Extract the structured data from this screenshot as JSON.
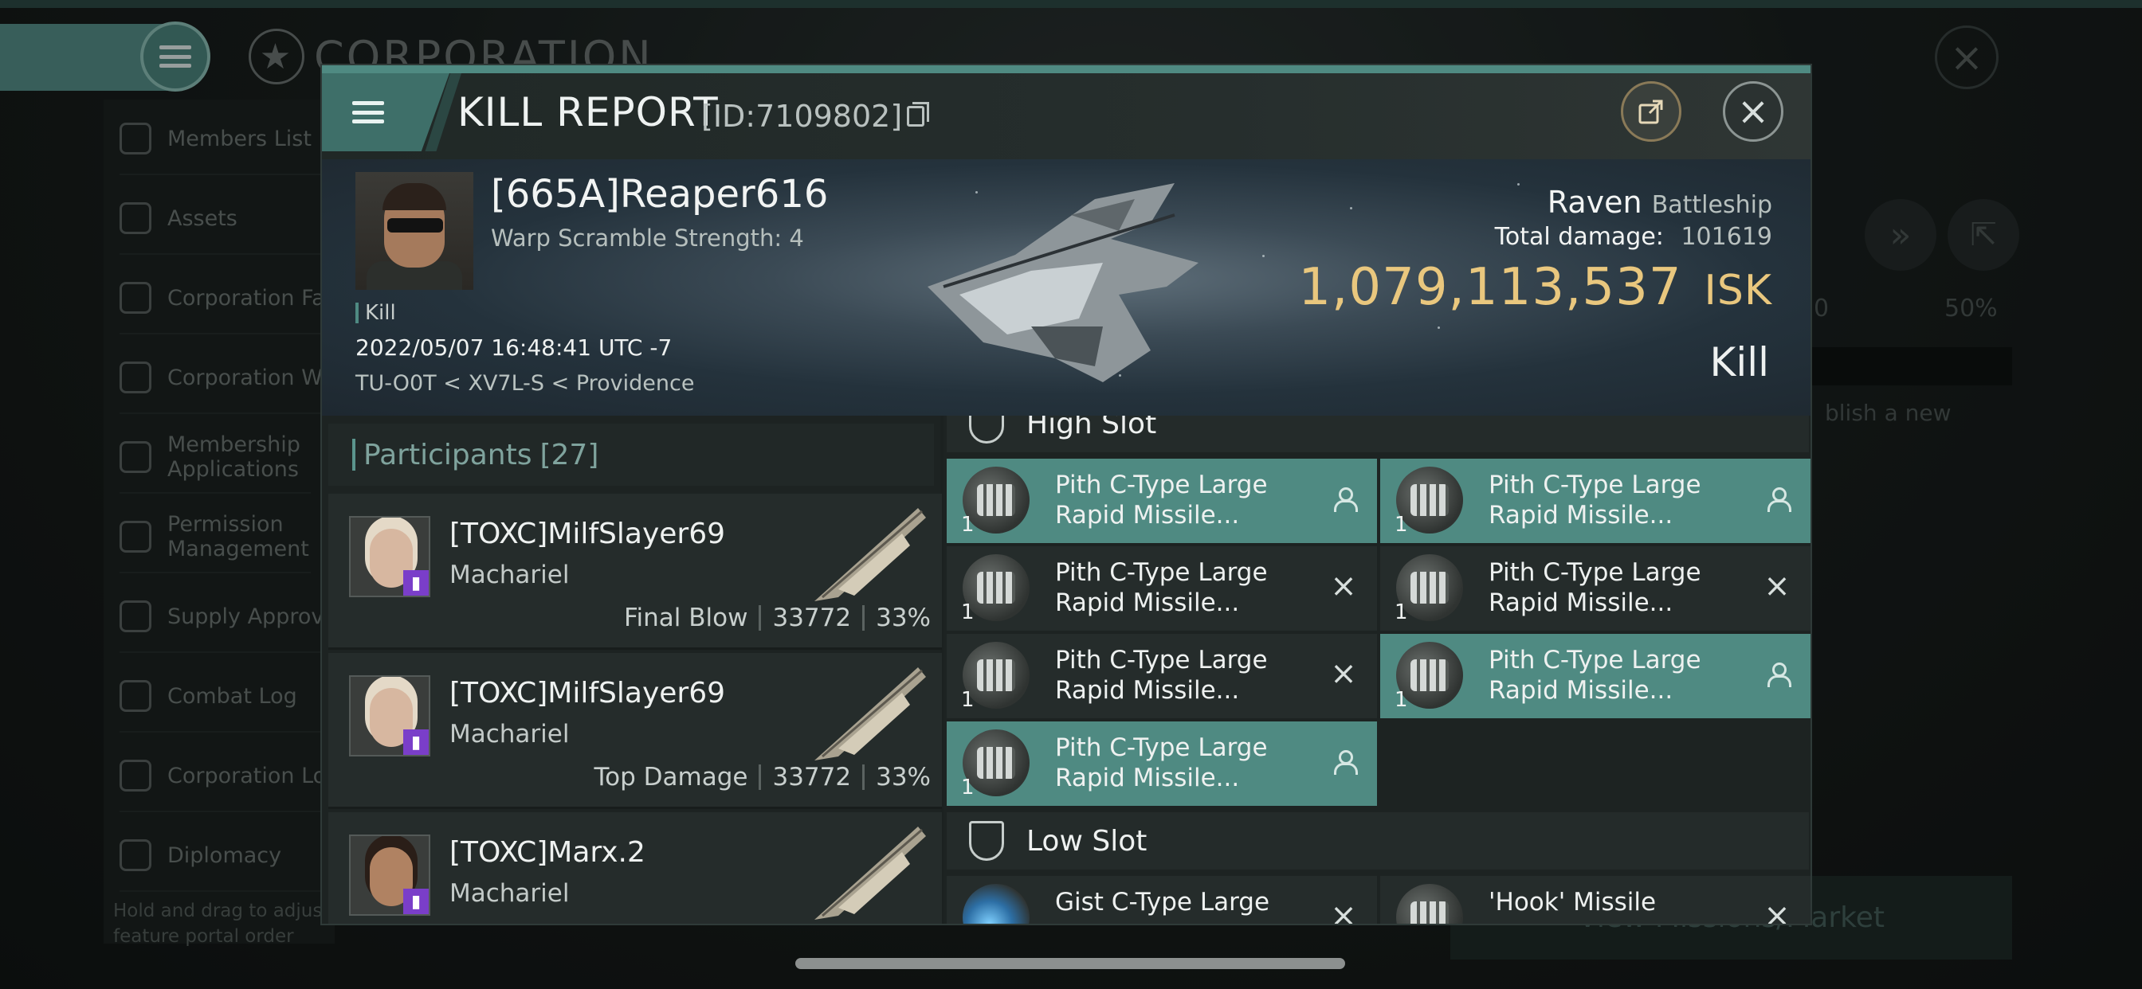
{
  "background": {
    "title": "CORPORATION",
    "sidebar": [
      {
        "label": "Members List",
        "icon": "members-icon"
      },
      {
        "label": "Assets",
        "icon": "assets-icon"
      },
      {
        "label": "Corporation Fa",
        "icon": "facilities-icon"
      },
      {
        "label": "Corporation Wa",
        "icon": "wallet-icon"
      },
      {
        "label": "Membership Applications",
        "icon": "applications-icon"
      },
      {
        "label": "Permission Management",
        "icon": "permission-icon"
      },
      {
        "label": "Supply Approva",
        "icon": "supply-icon"
      },
      {
        "label": "Combat Log",
        "icon": "combat-log-icon"
      },
      {
        "label": "Corporation Lo",
        "icon": "corp-log-icon"
      },
      {
        "label": "Diplomacy",
        "icon": "diplomacy-icon"
      }
    ],
    "hint": "Hold and drag to adjust feature portal order",
    "right_value_0": "0",
    "right_value_pct": "50%",
    "right_hint": "blish a new",
    "market_button": "View Missions/Market"
  },
  "dialog": {
    "title": "KILL REPORT",
    "id": "[ID:7109802]",
    "victim": {
      "name": "[665A]Reaper616",
      "warp": "Warp Scramble Strength: 4",
      "tag": "Kill",
      "datetime": "2022/05/07 16:48:41 UTC -7",
      "location": "TU-O0T < XV7L-S < Providence",
      "ship": "Raven",
      "ship_class": "Battleship",
      "total_damage_label": "Total damage:",
      "total_damage": "101619",
      "isk_value": "1,079,113,537",
      "isk_unit": "ISK",
      "result": "Kill"
    },
    "participants": {
      "label": "Participants",
      "count": "[27]",
      "rows": [
        {
          "name": "[TOXC]MilfSlayer69",
          "ship": "Machariel",
          "role": "Final Blow",
          "damage": "33772",
          "pct": "33%"
        },
        {
          "name": "[TOXC]MilfSlayer69",
          "ship": "Machariel",
          "role": "Top Damage",
          "damage": "33772",
          "pct": "33%"
        },
        {
          "name": "[TOXC]Marx.2",
          "ship": "Machariel",
          "role": "",
          "damage": "",
          "pct": ""
        }
      ]
    },
    "high_slot": {
      "label": "High Slot",
      "modules": [
        {
          "name": "Pith C-Type Large Rapid Missile...",
          "qty": "1",
          "state": "dropped"
        },
        {
          "name": "Pith C-Type Large Rapid Missile...",
          "qty": "1",
          "state": "dropped"
        },
        {
          "name": "Pith C-Type Large Rapid Missile...",
          "qty": "1",
          "state": "destroyed"
        },
        {
          "name": "Pith C-Type Large Rapid Missile...",
          "qty": "1",
          "state": "destroyed"
        },
        {
          "name": "Pith C-Type Large Rapid Missile...",
          "qty": "1",
          "state": "destroyed"
        },
        {
          "name": "Pith C-Type Large Rapid Missile...",
          "qty": "1",
          "state": "dropped"
        },
        {
          "name": "Pith C-Type Large Rapid Missile...",
          "qty": "1",
          "state": "dropped"
        }
      ]
    },
    "low_slot": {
      "label": "Low Slot",
      "modules": [
        {
          "name": "Gist C-Type Large",
          "state": "destroyed"
        },
        {
          "name": "'Hook' Missile",
          "state": "destroyed"
        }
      ]
    },
    "colors": {
      "accent": "#4f8a82",
      "isk": "#e9c77e",
      "omega_badge": "#7a3ec9"
    }
  }
}
